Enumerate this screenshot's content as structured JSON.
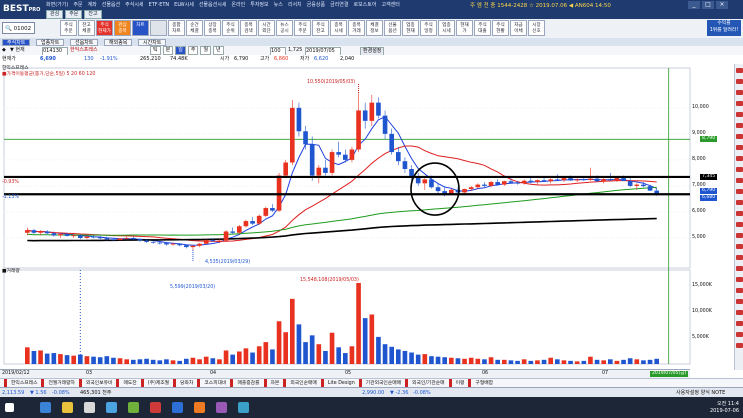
{
  "topbar": {
    "logo": "BEST",
    "logo_sub": "PRO",
    "menu": [
      "화면(가기)",
      "주문",
      "계좌",
      "선물옵션",
      "주식시세",
      "ETF·ETN",
      "ELW시세",
      "선물옵션시세",
      "온라인",
      "투자정보",
      "뉴스",
      "리서치",
      "금융상품",
      "금리연결",
      "로보스토어",
      "고객센터"
    ],
    "minis": [
      "관심",
      "주문",
      "잔고"
    ],
    "clock": "주 엠 전 충  1544-2428  ☆  2019.07.06  ◀  AN604 14:50",
    "window_buttons": [
      "_",
      "□",
      "×"
    ]
  },
  "toolbar": {
    "search_value": "01002",
    "buttons": [
      {
        "label": "주식\n주문",
        "style": ""
      },
      {
        "label": "잔고\n체결",
        "style": ""
      },
      {
        "label": "주식\n현재가",
        "style": "red"
      },
      {
        "label": "관심\n종목",
        "style": "orange"
      },
      {
        "label": "차트",
        "style": "blue"
      },
      {
        "label": "",
        "style": "grey"
      },
      {
        "label": "종합\n차트",
        "style": ""
      },
      {
        "label": "순간\n체결",
        "style": ""
      },
      {
        "label": "상장\n종목",
        "style": ""
      },
      {
        "label": "주식\n순위",
        "style": ""
      },
      {
        "label": "종목\n검색",
        "style": ""
      },
      {
        "label": "시간\n외단",
        "style": ""
      },
      {
        "label": "뉴스\n공시",
        "style": ""
      },
      {
        "label": "주식\n주문",
        "style": ""
      },
      {
        "label": "주식\n잔고",
        "style": ""
      },
      {
        "label": "종목\n시세",
        "style": ""
      },
      {
        "label": "종목\n거래",
        "style": ""
      },
      {
        "label": "체결\n정보",
        "style": ""
      },
      {
        "label": "선물\n옵션",
        "style": ""
      },
      {
        "label": "업종\n현재",
        "style": ""
      },
      {
        "label": "주식\n일정",
        "style": ""
      },
      {
        "label": "업종\n시세",
        "style": ""
      },
      {
        "label": "현재\n가",
        "style": ""
      },
      {
        "label": "주식\n대출",
        "style": ""
      },
      {
        "label": "주식\n현황",
        "style": ""
      },
      {
        "label": "자금\n이체",
        "style": ""
      },
      {
        "label": "시장\n신호",
        "style": ""
      }
    ],
    "promo": "수익률\n1위를 달려라!"
  },
  "tabs": [
    "주식차트",
    "업종차트",
    "선옵차트",
    "해외종목",
    "시간차트"
  ],
  "controls": {
    "code": "014130",
    "name_label": "한익스프레스",
    "period_buttons": [
      "틱",
      "분",
      "일",
      "주",
      "월",
      "년"
    ],
    "count": "100",
    "interval": "1,725",
    "date": "2019/07/05",
    "apply": "환경설정"
  },
  "info": {
    "label_price": "현재가",
    "price": "6,690",
    "change": "130",
    "pct": "-1.91%",
    "volume": "265,210",
    "amount": "74.48K",
    "open_label": "시가",
    "open": "6,790",
    "high_label": "고가",
    "high": "6,860",
    "low_label": "저가",
    "low": "6,620",
    "prev": "2,040"
  },
  "chart": {
    "panel_title": "한익스프레스",
    "ma_legend": "■가격이동평균(종가,단순,5일) 5  20  60  120",
    "vol_title": "■거래량",
    "price_max_label": "10,550(2019/05/03)",
    "price_min_label": "4,535(2019/03/29)",
    "vol_max_label": "15,548,108(2019/05/03)",
    "vol_min_label": "5,599(2019/03/20)",
    "left_label_1": "-0.93%",
    "left_label_2": "-1.13%",
    "price_axis": [
      "10,000",
      "9,000",
      "8,000",
      "7,000",
      "6,000",
      "5,000"
    ],
    "right_tags": [
      "8,790",
      "7,345",
      "6,790",
      "6,680"
    ],
    "vol_axis": [
      "15,000K",
      "10,000K",
      "5,000K"
    ],
    "time_labels": [
      "2019/02/12",
      "03",
      "04",
      "05",
      "06",
      "07"
    ],
    "time_tag": "2019/07/05(금)"
  },
  "indicators": [
    "한익스프레스",
    "전월거래량차",
    "외국인보유비",
    "매도잔",
    "(주)제조월",
    "당좌차",
    "코스피대비",
    "매출증감률",
    "자본",
    "외국인순매매",
    "Lite Design",
    "기관외국인순매매",
    "외국인/기관순매",
    "이평",
    "구형배합"
  ],
  "status": {
    "k1": "2,113.59",
    "k1c": "▼ 1.56",
    "k1p": "-0.08%",
    "k1v": "465,301 천주",
    "k2": "2,990.00",
    "k2c": "▼ -2.36",
    "k2p": "-0.08%",
    "right": "사용자설정  양식  NOTE"
  },
  "tray": {
    "time": "오전 11:4",
    "date": "2019-07-06"
  },
  "colors": {
    "up": "#e8321f",
    "down": "#1f56d0",
    "ma5": "#1f3fe0",
    "ma20": "#e01f1f",
    "ma60": "#1e9b1e",
    "ma120": "#000000"
  },
  "chart_data": {
    "type": "candlestick",
    "price_ylim": [
      4000,
      11300
    ],
    "volume_ylim": [
      0,
      16500
    ],
    "candles": [
      [
        5200,
        5400,
        5100,
        5300,
        3200
      ],
      [
        5300,
        5350,
        5150,
        5200,
        2500
      ],
      [
        5200,
        5300,
        5100,
        5250,
        2600
      ],
      [
        5250,
        5300,
        5150,
        5180,
        2000
      ],
      [
        5180,
        5250,
        5050,
        5100,
        2100
      ],
      [
        5100,
        5200,
        5000,
        5150,
        1900
      ],
      [
        5150,
        5200,
        5050,
        5080,
        1700
      ],
      [
        5080,
        5150,
        5000,
        5100,
        1600
      ],
      [
        5100,
        5150,
        4950,
        5000,
        1800
      ],
      [
        5000,
        5100,
        4950,
        5050,
        1500
      ],
      [
        5050,
        5100,
        4980,
        5020,
        1400
      ],
      [
        5020,
        5080,
        4950,
        4990,
        1300
      ],
      [
        4990,
        5050,
        4900,
        4950,
        1500
      ],
      [
        4950,
        5000,
        4880,
        4920,
        1200
      ],
      [
        4920,
        5000,
        4900,
        4980,
        1100
      ],
      [
        4980,
        5050,
        4950,
        5000,
        900
      ],
      [
        5000,
        5050,
        4930,
        4950,
        800
      ],
      [
        4950,
        4980,
        4850,
        4900,
        900
      ],
      [
        4900,
        4950,
        4800,
        4850,
        1000
      ],
      [
        4850,
        4900,
        4780,
        4820,
        800
      ],
      [
        4820,
        4880,
        4750,
        4800,
        700
      ],
      [
        4800,
        4850,
        4700,
        4750,
        900
      ],
      [
        4750,
        4820,
        4700,
        4780,
        700
      ],
      [
        4780,
        4800,
        4680,
        4720,
        600
      ],
      [
        4720,
        4760,
        4600,
        4650,
        1000
      ],
      [
        4650,
        4720,
        4535,
        4700,
        1200
      ],
      [
        4700,
        4800,
        4650,
        4780,
        900
      ],
      [
        4780,
        4950,
        4750,
        4920,
        1400
      ],
      [
        4920,
        5000,
        4850,
        4880,
        1100
      ],
      [
        4880,
        4950,
        4800,
        4900,
        900
      ],
      [
        4900,
        5300,
        4880,
        5250,
        2600
      ],
      [
        5250,
        5400,
        5150,
        5200,
        1800
      ],
      [
        5200,
        5500,
        5150,
        5450,
        2400
      ],
      [
        5450,
        5700,
        5400,
        5650,
        3000
      ],
      [
        5650,
        5800,
        5500,
        5550,
        2200
      ],
      [
        5550,
        5900,
        5500,
        5850,
        3400
      ],
      [
        5850,
        6200,
        5800,
        6150,
        4200
      ],
      [
        6150,
        6300,
        6000,
        6050,
        2800
      ],
      [
        6050,
        7500,
        6000,
        7400,
        8200
      ],
      [
        7400,
        8000,
        7300,
        7900,
        6100
      ],
      [
        7900,
        10300,
        7800,
        10000,
        12500
      ],
      [
        10000,
        10200,
        8900,
        9100,
        7600
      ],
      [
        9100,
        9300,
        8400,
        8600,
        4200
      ],
      [
        8600,
        8900,
        7200,
        7400,
        5500
      ],
      [
        7400,
        7800,
        7100,
        7700,
        3800
      ],
      [
        7700,
        8000,
        7400,
        7500,
        2500
      ],
      [
        7500,
        8400,
        7400,
        8300,
        6000
      ],
      [
        8300,
        8700,
        8100,
        8200,
        3200
      ],
      [
        8200,
        8400,
        7900,
        8000,
        2100
      ],
      [
        8000,
        8500,
        7900,
        8400,
        3400
      ],
      [
        8400,
        10550,
        8300,
        9900,
        15548
      ],
      [
        9900,
        10200,
        9200,
        9500,
        8800
      ],
      [
        9500,
        10500,
        9300,
        10200,
        9500
      ],
      [
        10200,
        10400,
        9600,
        9700,
        5200
      ],
      [
        9700,
        9900,
        8800,
        9000,
        3800
      ],
      [
        9000,
        9200,
        8200,
        8300,
        3300
      ],
      [
        8300,
        8500,
        7800,
        7950,
        2800
      ],
      [
        7950,
        8100,
        7500,
        7650,
        2500
      ],
      [
        7650,
        7800,
        7200,
        7350,
        2200
      ],
      [
        7350,
        7500,
        7000,
        7100,
        1800
      ],
      [
        7100,
        7300,
        6850,
        7250,
        1900
      ],
      [
        7250,
        7400,
        6900,
        6950,
        1500
      ],
      [
        6950,
        7100,
        6700,
        6800,
        1400
      ],
      [
        6800,
        6950,
        6600,
        6700,
        1300
      ],
      [
        6700,
        6900,
        6650,
        6850,
        1200
      ],
      [
        6850,
        6950,
        6700,
        6750,
        1100
      ],
      [
        6750,
        6900,
        6700,
        6880,
        1000
      ],
      [
        6880,
        7000,
        6800,
        6950,
        1200
      ],
      [
        6950,
        7100,
        6900,
        7050,
        1000
      ],
      [
        7050,
        7150,
        6950,
        7000,
        900
      ],
      [
        7000,
        7200,
        6950,
        7150,
        1300
      ],
      [
        7150,
        7250,
        7000,
        7050,
        800
      ],
      [
        7050,
        7200,
        7000,
        7180,
        800
      ],
      [
        7180,
        7300,
        7100,
        7120,
        700
      ],
      [
        7120,
        7200,
        7050,
        7100,
        600
      ],
      [
        7100,
        7250,
        7050,
        7200,
        900
      ],
      [
        7200,
        7300,
        7100,
        7150,
        600
      ],
      [
        7150,
        7250,
        7050,
        7220,
        700
      ],
      [
        7220,
        7350,
        7150,
        7180,
        800
      ],
      [
        7180,
        7300,
        7100,
        7250,
        1200
      ],
      [
        7250,
        7450,
        7200,
        7220,
        900
      ],
      [
        7220,
        7350,
        7150,
        7300,
        700
      ],
      [
        7300,
        7400,
        7200,
        7210,
        600
      ],
      [
        7210,
        7300,
        7150,
        7250,
        500
      ],
      [
        7250,
        7350,
        7200,
        7230,
        600
      ],
      [
        7230,
        7700,
        7200,
        7280,
        1400
      ],
      [
        7280,
        7400,
        7150,
        7180,
        800
      ],
      [
        7180,
        7300,
        7100,
        7260,
        700
      ],
      [
        7260,
        7500,
        7200,
        7220,
        900
      ],
      [
        7220,
        7350,
        7150,
        7300,
        600
      ],
      [
        7300,
        7400,
        7200,
        7190,
        800
      ],
      [
        7190,
        7300,
        6950,
        7000,
        1100
      ],
      [
        7000,
        7100,
        6850,
        7050,
        900
      ],
      [
        7050,
        7150,
        6950,
        6990,
        700
      ],
      [
        6990,
        7050,
        6800,
        6820,
        800
      ],
      [
        6820,
        6900,
        6620,
        6690,
        1000
      ]
    ],
    "ma_periods": [
      5,
      20,
      60,
      120
    ]
  }
}
